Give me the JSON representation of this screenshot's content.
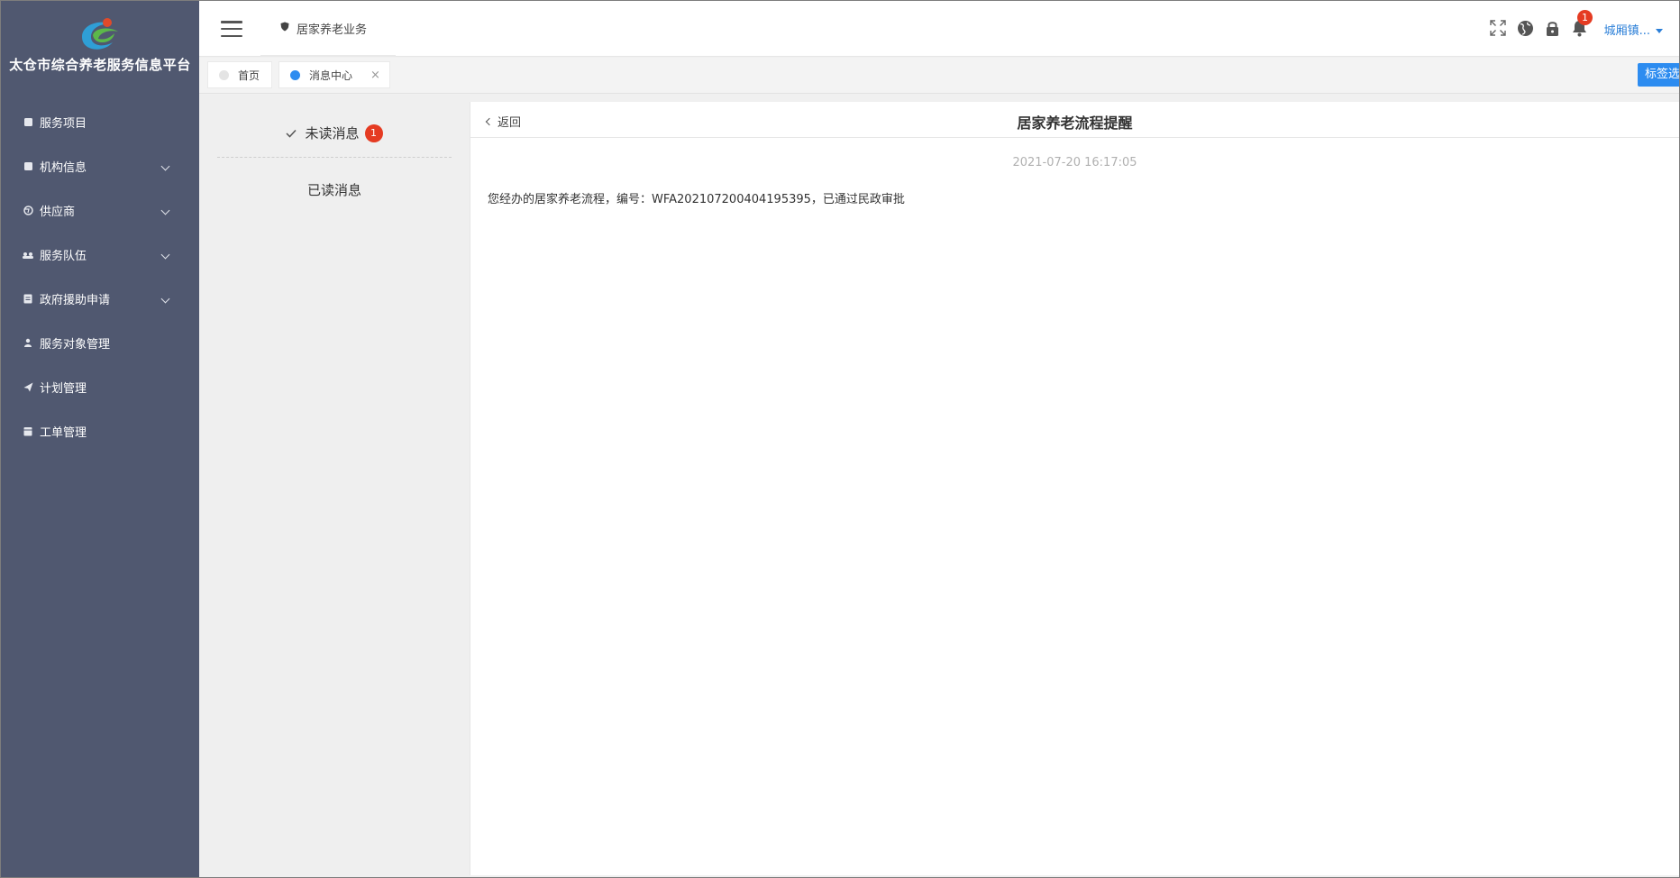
{
  "app": {
    "title": "太仓市综合养老服务信息平台"
  },
  "sidebar": {
    "items": [
      {
        "label": "服务项目",
        "icon": "book-icon",
        "has_children": false
      },
      {
        "label": "机构信息",
        "icon": "book-icon",
        "has_children": true
      },
      {
        "label": "供应商",
        "icon": "globe-icon",
        "has_children": true
      },
      {
        "label": "服务队伍",
        "icon": "group-icon",
        "has_children": true
      },
      {
        "label": "政府援助申请",
        "icon": "document-icon",
        "has_children": true
      },
      {
        "label": "服务对象管理",
        "icon": "person-icon",
        "has_children": false
      },
      {
        "label": "计划管理",
        "icon": "send-icon",
        "has_children": false
      },
      {
        "label": "工单管理",
        "icon": "calendar-icon",
        "has_children": false
      }
    ]
  },
  "header": {
    "nav_label": "居家养老业务",
    "notification_count": "1",
    "user_name": "城厢镇..."
  },
  "tabs": {
    "home_label": "首页",
    "message_center_label": "消息中心",
    "close_glyph": "×",
    "options_label": "标签选项"
  },
  "messages": {
    "unread_label": "未读消息",
    "unread_count": "1",
    "read_label": "已读消息"
  },
  "detail": {
    "back_label": "返回",
    "title": "居家养老流程提醒",
    "time": "2021-07-20 16:17:05",
    "body": "您经办的居家养老流程，编号：WFA202107200404195395，已通过民政审批"
  },
  "colors": {
    "sidebar_bg": "#505870",
    "accent_blue": "#2d8cf0",
    "badge_red": "#e53b22"
  }
}
